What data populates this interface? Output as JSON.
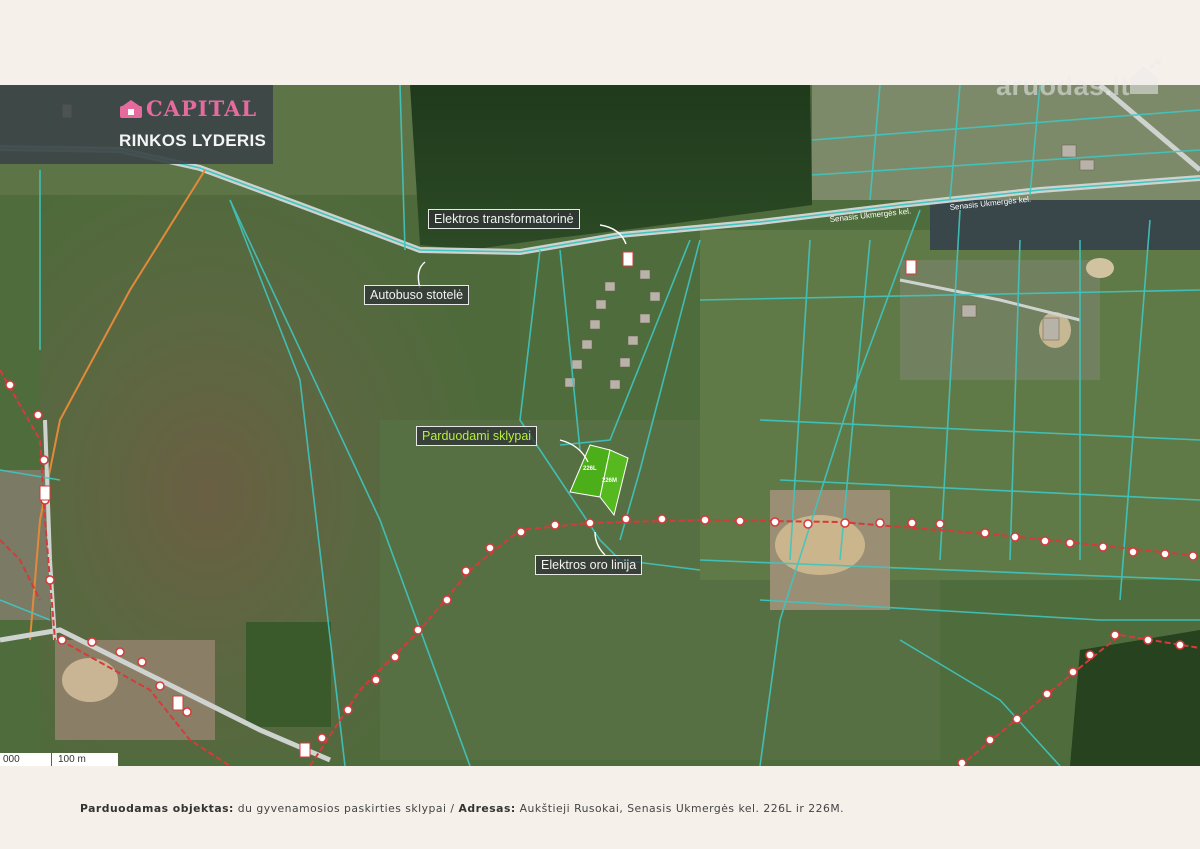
{
  "brand": {
    "name": "CAPITAL",
    "tagline": "RINKOS LYDERIS"
  },
  "watermark": "aruodas.lt",
  "callouts": {
    "transformer": "Elektros transformatorinė",
    "bus_stop": "Autobuso stotelė",
    "plots": "Parduodami sklypai",
    "power_line": "Elektros oro linija"
  },
  "plots": [
    "226L",
    "226M"
  ],
  "road_labels": [
    "Senasis Ukmergės kel.",
    "Senasis Ukmergės kel."
  ],
  "scale": {
    "start": "000",
    "label": "100 m"
  },
  "caption": {
    "object_label": "Parduodamas objektas:",
    "object_value": " du gyvenamosios paskirties sklypai / ",
    "address_label": "Adresas:",
    "address_value": " Aukštieji Rusokai, Senasis Ukmergės kel. 226L ir 226M."
  },
  "colors": {
    "parcel_line": "#3fc6c0",
    "power_line": "#d63a3a",
    "plot_fill": "#4caf1a",
    "logo_accent": "#e56b9e"
  }
}
